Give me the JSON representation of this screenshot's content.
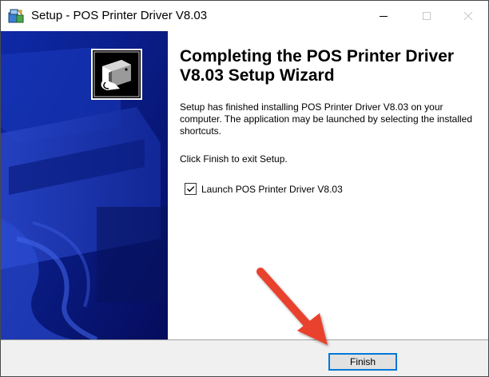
{
  "window": {
    "title": "Setup - POS Printer Driver V8.03"
  },
  "content": {
    "heading": "Completing the POS Printer Driver V8.03 Setup Wizard",
    "body": "Setup has finished installing POS Printer Driver V8.03 on your computer. The application may be launched by selecting the installed shortcuts.",
    "finish_hint": "Click Finish to exit Setup.",
    "launch_checkbox": {
      "label": "Launch POS Printer Driver V8.03",
      "checked": true
    }
  },
  "buttons": {
    "finish": "Finish"
  },
  "colors": {
    "banner": "#0b1a8a",
    "arrow": "#e8432e",
    "focus_border": "#0078d7"
  },
  "icons": {
    "app": "setup-installer-icon",
    "banner": "printer-logo-icon"
  }
}
